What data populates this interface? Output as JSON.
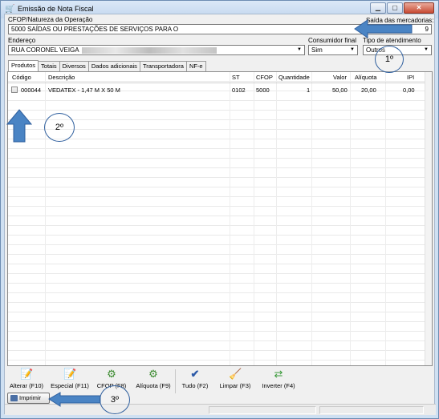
{
  "window": {
    "title": "Emissão de Nota Fiscal",
    "buttons": [
      "minimize",
      "maximize",
      "close"
    ]
  },
  "form": {
    "cfop_label": "CFOP/Natureza da Operação",
    "cfop_value": "5000 SAÍDAS OU PRESTAÇÕES DE SERVIÇOS PARA O",
    "saida_label": "Saída das mercadorias:",
    "saida_value": "9",
    "endereco_label": "Endereço",
    "endereco_value": "RUA CORONEL VEIGA",
    "consumidor_label": "Consumidor final",
    "consumidor_value": "Sim",
    "atendimento_label": "Tipo de atendimento",
    "atendimento_value": "Outros"
  },
  "tabs": [
    {
      "label": "Produtos",
      "active": true
    },
    {
      "label": "Totais"
    },
    {
      "label": "Diversos"
    },
    {
      "label": "Dados adicionais"
    },
    {
      "label": "Transportadora"
    },
    {
      "label": "NF-e"
    }
  ],
  "table": {
    "columns": [
      "Código",
      "Descrição",
      "ST",
      "CFOP",
      "Quantidade",
      "Valor",
      "Alíquota",
      "IPI"
    ],
    "rows": [
      {
        "codigo": "000044",
        "descricao": "VEDATEX - 1,47 M X 50 M",
        "st": "0102",
        "cfop": "5000",
        "quantidade": "1",
        "valor": "50,00",
        "aliquota": "20,00",
        "ipi": "0,00"
      }
    ]
  },
  "toolbar": [
    {
      "label": "Alterar (F10)",
      "icon": "edit-icon"
    },
    {
      "label": "Especial (F11)",
      "icon": "edit-special-icon"
    },
    {
      "label": "CFOP (F8)",
      "icon": "cfop-icon"
    },
    {
      "label": "Alíquota (F9)",
      "icon": "aliquota-icon"
    },
    {
      "label": "Tudo (F2)",
      "icon": "check-all-icon"
    },
    {
      "label": "Limpar (F3)",
      "icon": "broom-icon"
    },
    {
      "label": "Inverter (F4)",
      "icon": "invert-icon"
    }
  ],
  "imprimir_label": "Imprimir",
  "annotations": {
    "step1": "1º",
    "step2": "2º",
    "step3": "3º",
    "arrow_color": "#4a84c4"
  }
}
